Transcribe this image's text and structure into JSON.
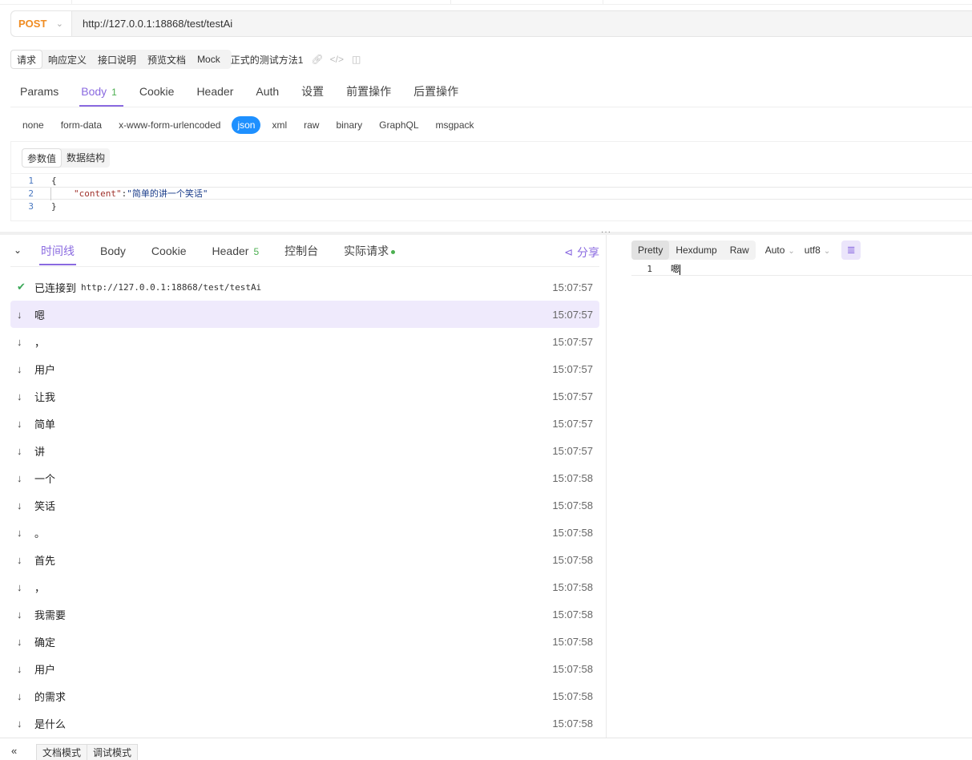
{
  "request": {
    "method": "POST",
    "url": "http://127.0.0.1:18868/test/testAi"
  },
  "doc_tabs": [
    "请求",
    "响应定义",
    "接口说明",
    "预览文档",
    "Mock"
  ],
  "doc_title": "正式的测试方法1",
  "req_tabs": {
    "params": "Params",
    "body": "Body",
    "body_count": "1",
    "cookie": "Cookie",
    "header": "Header",
    "auth": "Auth",
    "settings": "设置",
    "pre": "前置操作",
    "post": "后置操作"
  },
  "body_types": [
    "none",
    "form-data",
    "x-www-form-urlencoded",
    "json",
    "xml",
    "raw",
    "binary",
    "GraphQL",
    "msgpack"
  ],
  "editor": {
    "subtabs": [
      "参数值",
      "数据结构"
    ],
    "lines": [
      {
        "n": "1",
        "text": "{"
      },
      {
        "n": "2",
        "key": "\"content\"",
        "sep": ":",
        "value": "\"简单的讲一个笑话\""
      },
      {
        "n": "3",
        "text": "}"
      }
    ]
  },
  "response_tabs": {
    "timeline": "时间线",
    "body": "Body",
    "cookie": "Cookie",
    "header": "Header",
    "header_count": "5",
    "console": "控制台",
    "actual": "实际请求",
    "share": "分享"
  },
  "timeline": {
    "connected_label": "已连接到",
    "connected_url": "http://127.0.0.1:18868/test/testAi",
    "connected_time": "15:07:57",
    "events": [
      {
        "text": "嗯",
        "time": "15:07:57"
      },
      {
        "text": "，",
        "time": "15:07:57"
      },
      {
        "text": "用户",
        "time": "15:07:57"
      },
      {
        "text": "让我",
        "time": "15:07:57"
      },
      {
        "text": "简单",
        "time": "15:07:57"
      },
      {
        "text": "讲",
        "time": "15:07:57"
      },
      {
        "text": "一个",
        "time": "15:07:58"
      },
      {
        "text": "笑话",
        "time": "15:07:58"
      },
      {
        "text": "。",
        "time": "15:07:58"
      },
      {
        "text": "首先",
        "time": "15:07:58"
      },
      {
        "text": "，",
        "time": "15:07:58"
      },
      {
        "text": "我需要",
        "time": "15:07:58"
      },
      {
        "text": "确定",
        "time": "15:07:58"
      },
      {
        "text": "用户",
        "time": "15:07:58"
      },
      {
        "text": "的需求",
        "time": "15:07:58"
      },
      {
        "text": "是什么",
        "time": "15:07:58"
      }
    ]
  },
  "viewer": {
    "formats": [
      "Pretty",
      "Hexdump",
      "Raw"
    ],
    "mode": "Auto",
    "encoding": "utf8",
    "line_number": "1",
    "content": "嗯"
  },
  "bottom": {
    "tabs": [
      "文档模式",
      "调试模式"
    ]
  },
  "icons": {
    "down_arrow": "arrow-down-icon",
    "check": "check-circle-icon",
    "share": "share-icon",
    "wrap": "wrap-lines-icon"
  },
  "colors": {
    "accent": "#8a6ae0",
    "post": "#f08c22",
    "json_pill": "#1e90ff",
    "success": "#4caf50"
  }
}
